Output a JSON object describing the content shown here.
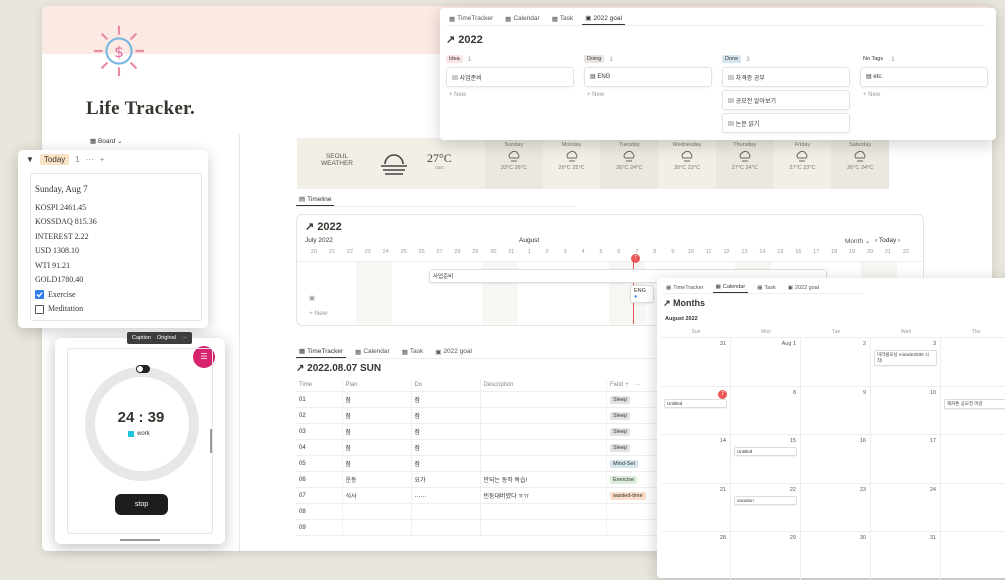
{
  "page": {
    "title": "Life Tracker.",
    "board_label": "Board"
  },
  "weather": {
    "city": "SEOUL",
    "label": "WEATHER",
    "temp": "27°C",
    "desc": "mist",
    "days": [
      {
        "name": "Sunday",
        "hi": "33°C",
        "lo": "26°C"
      },
      {
        "name": "Monday",
        "hi": "26°C",
        "lo": "25°C"
      },
      {
        "name": "Tuesday",
        "hi": "26°C",
        "lo": "24°C"
      },
      {
        "name": "Wednesday",
        "hi": "30°C",
        "lo": "22°C"
      },
      {
        "name": "Thursday",
        "hi": "27°C",
        "lo": "24°C"
      },
      {
        "name": "Friday",
        "hi": "27°C",
        "lo": "23°C"
      },
      {
        "name": "Saturday",
        "hi": "26°C",
        "lo": "24°C"
      }
    ]
  },
  "timeline": {
    "tab": "Timeline",
    "title": "2022",
    "month_left": "July 2022",
    "month_mid": "August",
    "view": "Month",
    "today_btn": "Today",
    "days": [
      "20",
      "21",
      "22",
      "23",
      "24",
      "25",
      "26",
      "27",
      "28",
      "29",
      "30",
      "31",
      "1",
      "2",
      "3",
      "4",
      "5",
      "6",
      "7",
      "8",
      "9",
      "10",
      "11",
      "12",
      "13",
      "14",
      "15",
      "16",
      "17",
      "18",
      "19",
      "20",
      "21",
      "22"
    ],
    "today_day": "7",
    "bar1": "사업준비",
    "bar2": "ENG",
    "new": "New"
  },
  "tracker": {
    "tabs": [
      "TimeTracker",
      "Calendar",
      "Task",
      "2022 goal"
    ],
    "title": "2022.08.07 SUN",
    "headers": [
      "Time",
      "Plan",
      "Do",
      "Description",
      "Field"
    ],
    "rows": [
      {
        "time": "01",
        "plan": "잠",
        "do": "잠",
        "desc": "",
        "field": "Sleep",
        "fc": "#e3e2e0"
      },
      {
        "time": "02",
        "plan": "잠",
        "do": "잠",
        "desc": "",
        "field": "Sleep",
        "fc": "#e3e2e0"
      },
      {
        "time": "03",
        "plan": "잠",
        "do": "잠",
        "desc": "",
        "field": "Sleep",
        "fc": "#e3e2e0"
      },
      {
        "time": "04",
        "plan": "잠",
        "do": "잠",
        "desc": "",
        "field": "Sleep",
        "fc": "#e3e2e0"
      },
      {
        "time": "05",
        "plan": "잠",
        "do": "잠",
        "desc": "",
        "field": "Mind-Set",
        "fc": "#d3e5ef"
      },
      {
        "time": "06",
        "plan": "운동",
        "do": "요가",
        "desc": "안되는 동작 복습!",
        "field": "Exercise",
        "fc": "#dbeddb"
      },
      {
        "time": "07",
        "plan": "식사",
        "do": "……",
        "desc": "빈둥대버렸다 ㅠㅠ",
        "field": "wasted-time",
        "fc": "#fadec9"
      },
      {
        "time": "08",
        "plan": "",
        "do": "",
        "desc": "",
        "field": "",
        "fc": ""
      },
      {
        "time": "09",
        "plan": "",
        "do": "",
        "desc": "",
        "field": "",
        "fc": ""
      }
    ]
  },
  "board": {
    "tabs": [
      "TimeTracker",
      "Calendar",
      "Task",
      "2022 goal"
    ],
    "title": "2022",
    "columns": [
      {
        "name": "Idea",
        "count": "1",
        "color": "#fbe4e4",
        "cards": [
          "사업준비"
        ]
      },
      {
        "name": "Doing",
        "count": "1",
        "color": "#e9e5e3",
        "cards": [
          "ENG"
        ]
      },
      {
        "name": "Done",
        "count": "3",
        "color": "#d3e5ef",
        "cards": [
          "자격증 공부",
          "공모전 알아보기",
          "논문 읽기"
        ]
      },
      {
        "name": "No Tags",
        "count": "1",
        "color": "",
        "cards": [
          "etc."
        ]
      }
    ],
    "new": "New"
  },
  "today": {
    "label": "Today",
    "count": "1",
    "date": "Sunday, Aug 7",
    "lines": [
      "KOSPI 2461.45",
      "KOSSDAQ 815.36",
      "INTEREST 2.22",
      "USD 1308.10",
      "WTI 91.21",
      "GOLD1780.40"
    ],
    "checks": [
      {
        "label": "Exercise",
        "on": true
      },
      {
        "label": "Meditation",
        "on": false
      }
    ]
  },
  "timer": {
    "time": "24 : 39",
    "label": "work",
    "stop": "stop",
    "caption": "Caption",
    "original": "Original"
  },
  "calendar": {
    "tabs": [
      "TimeTracker",
      "Calendar",
      "Task",
      "2022 goal"
    ],
    "title": "Months",
    "month": "August 2022",
    "weekdays": [
      "Sun",
      "Mon",
      "Tue",
      "Wed",
      "Thu"
    ],
    "weeks": [
      [
        {
          "d": "31"
        },
        {
          "d": "Aug 1"
        },
        {
          "d": "2"
        },
        {
          "d": "3",
          "ev": "미라클모닝 miracle2030 시작!"
        },
        {
          "d": ""
        }
      ],
      [
        {
          "d": "7",
          "ev": "Untitled",
          "today": true
        },
        {
          "d": "8"
        },
        {
          "d": "9"
        },
        {
          "d": "10"
        },
        {
          "d": "",
          "ev": "해커톤 공모전 마감"
        }
      ],
      [
        {
          "d": "14"
        },
        {
          "d": "15",
          "ev": "Untitled"
        },
        {
          "d": "16"
        },
        {
          "d": "17"
        },
        {
          "d": ""
        }
      ],
      [
        {
          "d": "21"
        },
        {
          "d": "22",
          "ev": "vacation"
        },
        {
          "d": "23"
        },
        {
          "d": "24"
        },
        {
          "d": ""
        }
      ],
      [
        {
          "d": "28"
        },
        {
          "d": "29"
        },
        {
          "d": "30"
        },
        {
          "d": "31"
        },
        {
          "d": ""
        }
      ]
    ]
  }
}
